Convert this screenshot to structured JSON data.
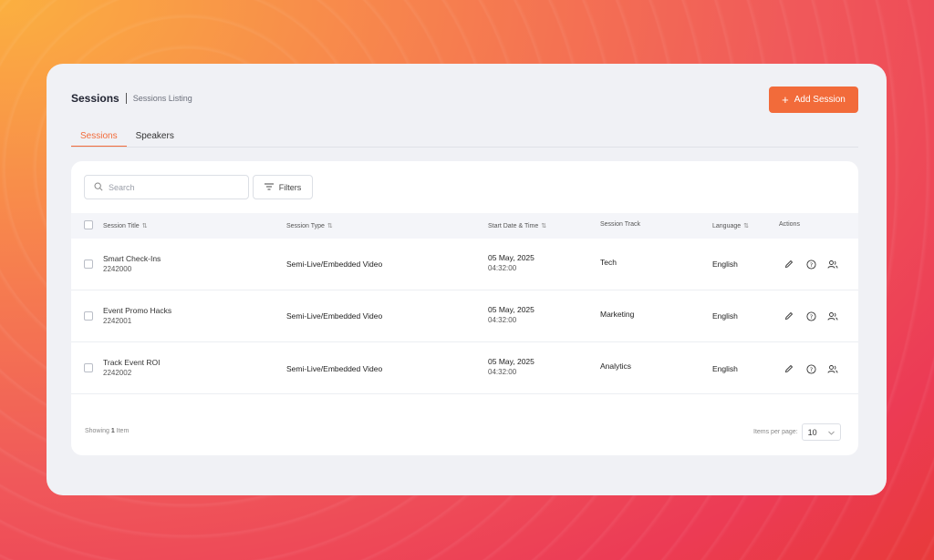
{
  "header": {
    "title": "Sessions",
    "subtitle": "Sessions Listing",
    "add_button": "Add Session"
  },
  "tabs": [
    {
      "label": "Sessions",
      "active": true
    },
    {
      "label": "Speakers",
      "active": false
    }
  ],
  "search": {
    "placeholder": "Search"
  },
  "filters_label": "Filters",
  "columns": {
    "title": "Session Title",
    "type": "Session Type",
    "datetime": "Start Date & Time",
    "track": "Session Track",
    "language": "Language",
    "actions": "Actions"
  },
  "rows": [
    {
      "title": "Smart Check-Ins",
      "id": "2242000",
      "type": "Semi-Live/Embedded Video",
      "date": "05 May, 2025",
      "time": "04:32:00",
      "track": "Tech",
      "language": "English"
    },
    {
      "title": "Event Promo Hacks",
      "id": "2242001",
      "type": "Semi-Live/Embedded Video",
      "date": "05 May, 2025",
      "time": "04:32:00",
      "track": "Marketing",
      "language": "English"
    },
    {
      "title": "Track Event ROI",
      "id": "2242002",
      "type": "Semi-Live/Embedded Video",
      "date": "05 May, 2025",
      "time": "04:32:00",
      "track": "Analytics",
      "language": "English"
    }
  ],
  "footer": {
    "showing_prefix": "Showing",
    "showing_count": "1",
    "showing_suffix": "Item",
    "per_page_label": "Items per page:",
    "per_page_value": "10"
  },
  "colors": {
    "accent": "#f26b3a",
    "panel": "#f0f1f5"
  },
  "icons": {
    "search": "search-icon",
    "filter": "filter-icon",
    "edit": "pencil-icon",
    "help": "question-circle-icon",
    "speakers": "users-icon",
    "chevron": "chevron-down-icon"
  }
}
